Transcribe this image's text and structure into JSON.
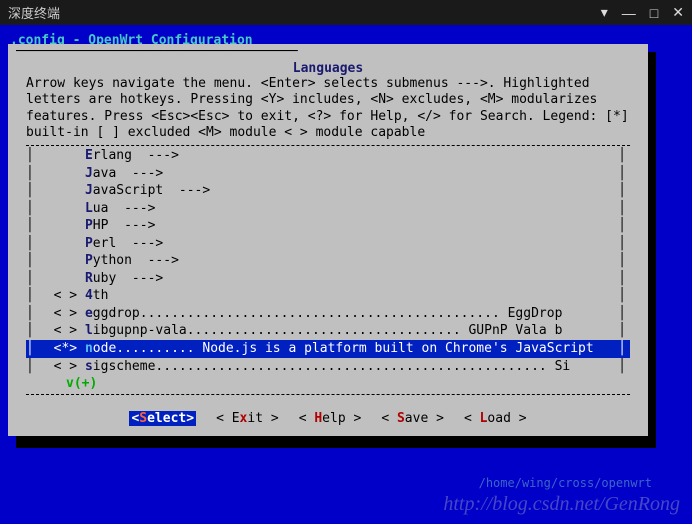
{
  "window": {
    "title": "深度终端"
  },
  "config_title": ".config - OpenWrt Configuration",
  "panel_title": "Languages",
  "help_text": "Arrow keys navigate the menu.  <Enter> selects submenus --->.  Highlighted letters are hotkeys.  Pressing <Y> includes, <N> excludes, <M> modularizes features.  Press <Esc><Esc> to exit, <?> for Help, </> for Search.  Legend: [*] built-in  [ ] excluded  <M> module  < > module capable",
  "menu": {
    "items": [
      {
        "lead": "    ",
        "hot": "E",
        "rest": "rlang  --->"
      },
      {
        "lead": "    ",
        "hot": "J",
        "rest": "ava  --->"
      },
      {
        "lead": "    ",
        "hot": "J",
        "rest": "avaScript  --->"
      },
      {
        "lead": "    ",
        "hot": "L",
        "rest": "ua  --->"
      },
      {
        "lead": "    ",
        "hot": "P",
        "rest": "HP  --->"
      },
      {
        "lead": "    ",
        "hot": "P",
        "rest": "erl  --->"
      },
      {
        "lead": "    ",
        "hot": "P",
        "rest": "ython  --->"
      },
      {
        "lead": "    ",
        "hot": "R",
        "rest": "uby  --->"
      },
      {
        "lead": "< > ",
        "hot": "4",
        "rest": "th"
      },
      {
        "lead": "< > ",
        "hot": "e",
        "rest": "ggdrop.............................................. EggDrop"
      },
      {
        "lead": "< > ",
        "hot": "l",
        "rest": "ibgupnp-vala................................... GUPnP Vala b"
      },
      {
        "lead": "<*> ",
        "hot": "n",
        "rest": "ode.......... Node.js is a platform built on Chrome's JavaScript",
        "selected": true
      },
      {
        "lead": "< > ",
        "hot": "s",
        "rest": "igscheme.................................................. Si"
      }
    ],
    "more": "v(+)"
  },
  "buttons": [
    {
      "hot": "S",
      "rest": "elect",
      "selected": true
    },
    {
      "pre": " E",
      "hot": "x",
      "rest": "it "
    },
    {
      "pre": " ",
      "hot": "H",
      "rest": "elp "
    },
    {
      "pre": " ",
      "hot": "S",
      "rest": "ave "
    },
    {
      "pre": " ",
      "hot": "L",
      "rest": "oad "
    }
  ],
  "watermark": "http://blog.csdn.net/GenRong",
  "pathline": "/home/wing/cross/openwrt"
}
